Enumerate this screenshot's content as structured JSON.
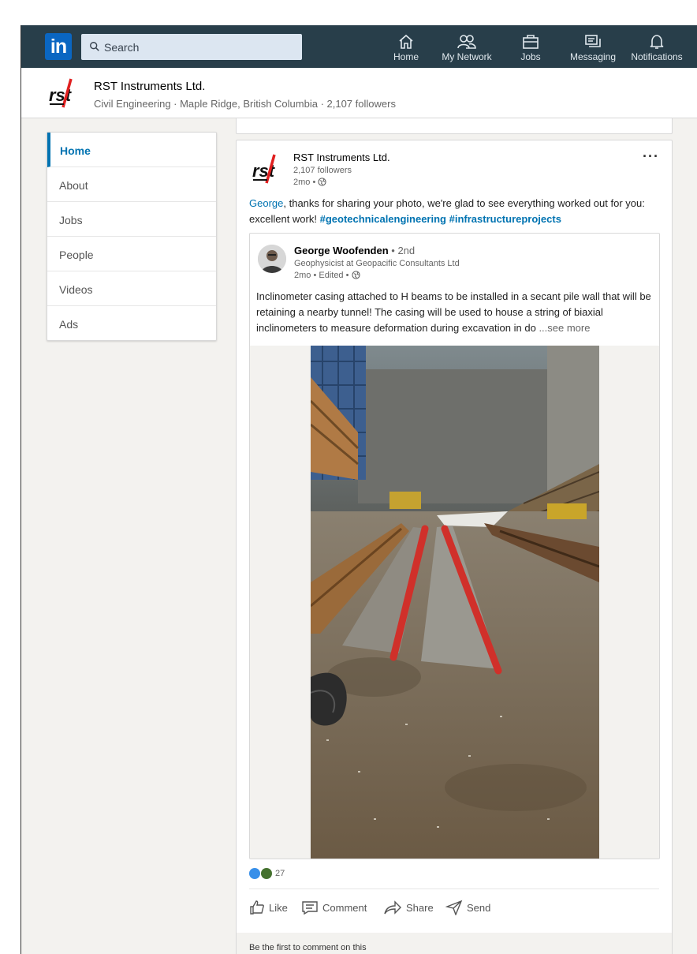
{
  "nav": {
    "logo_text": "in",
    "search_placeholder": "Search",
    "items": [
      {
        "label": "Home",
        "icon": "home-icon"
      },
      {
        "label": "My Network",
        "icon": "network-icon"
      },
      {
        "label": "Jobs",
        "icon": "briefcase-icon"
      },
      {
        "label": "Messaging",
        "icon": "messaging-icon"
      },
      {
        "label": "Notifications",
        "icon": "bell-icon"
      }
    ]
  },
  "company": {
    "name": "RST Instruments Ltd.",
    "subtitle": "Civil Engineering · Maple Ridge, British Columbia · 2,107 followers"
  },
  "sidebar": {
    "items": [
      {
        "label": "Home",
        "active": true
      },
      {
        "label": "About"
      },
      {
        "label": "Jobs"
      },
      {
        "label": "People"
      },
      {
        "label": "Videos"
      },
      {
        "label": "Ads"
      }
    ]
  },
  "post": {
    "author": "RST Instruments Ltd.",
    "followers": "2,107 followers",
    "time": "2mo •",
    "mention": "George",
    "caption_rest": ", thanks for sharing your photo, we're glad to see everything worked out for you: excellent work!",
    "hashtag_1": "#geotechnicalengineering",
    "hashtag_2": "#infrastructureprojects",
    "more_label": "···",
    "shared": {
      "author": "George Woofenden",
      "degree": "• 2nd",
      "title": "Geophysicist at Geopacific Consultants Ltd",
      "time": "2mo • Edited •",
      "body": "Inclinometer casing attached to H beams to be installed in a secant pile wall that will be retaining a nearby tunnel! The casing will be used to house a string of biaxial inclinometers to measure deformation during excavation in do",
      "see_more": "...see more"
    },
    "reactions_count": "27",
    "actions": {
      "like": "Like",
      "comment": "Comment",
      "share": "Share",
      "send": "Send"
    },
    "comment_prompt": "Be the first to comment on this"
  },
  "colors": {
    "nav_bg": "#283e4a",
    "brand_blue": "#0a66c2",
    "link_blue": "#0073b1",
    "page_bg": "#f3f2ef"
  }
}
